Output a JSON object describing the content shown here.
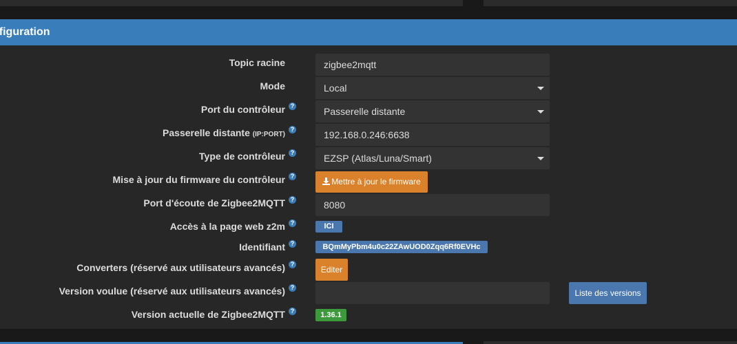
{
  "panel": {
    "title": "nfiguration"
  },
  "rows": {
    "topic": {
      "label": "Topic racine",
      "value": "zigbee2mqtt"
    },
    "mode": {
      "label": "Mode",
      "value": "Local"
    },
    "port": {
      "label": "Port du contrôleur",
      "value": "Passerelle distante"
    },
    "gateway": {
      "label": "Passerelle distante",
      "label_small": "(IP:PORT)",
      "value": "192.168.0.246:6638"
    },
    "type": {
      "label": "Type de contrôleur",
      "value": "EZSP (Atlas/Luna/Smart)"
    },
    "firmware": {
      "label": "Mise à jour du firmware du contrôleur",
      "button": "Mettre à jour le firmware"
    },
    "listen_port": {
      "label": "Port d'écoute de Zigbee2MQTT",
      "value": "8080"
    },
    "webpage": {
      "label": "Accès à la page web z2m",
      "link": "ICI"
    },
    "identifier": {
      "label": "Identifiant",
      "value": "BQmMyPbm4u0c22ZAwUOD0Zqq6Rf0EVHc"
    },
    "converters": {
      "label": "Converters (réservé aux utilisateurs avancés)",
      "button": "Editer"
    },
    "wanted_version": {
      "label": "Version voulue (réservé aux utilisateurs avancés)",
      "value": "",
      "button": "Liste des versions"
    },
    "current_version": {
      "label": "Version actuelle de Zigbee2MQTT",
      "value": "1.36.1"
    }
  },
  "help_glyph": "?",
  "colors": {
    "header": "#3a7dbb",
    "orange_button": "#d9822b",
    "identifier_badge": "#4a77ad",
    "version_badge": "#3c9a3c"
  }
}
